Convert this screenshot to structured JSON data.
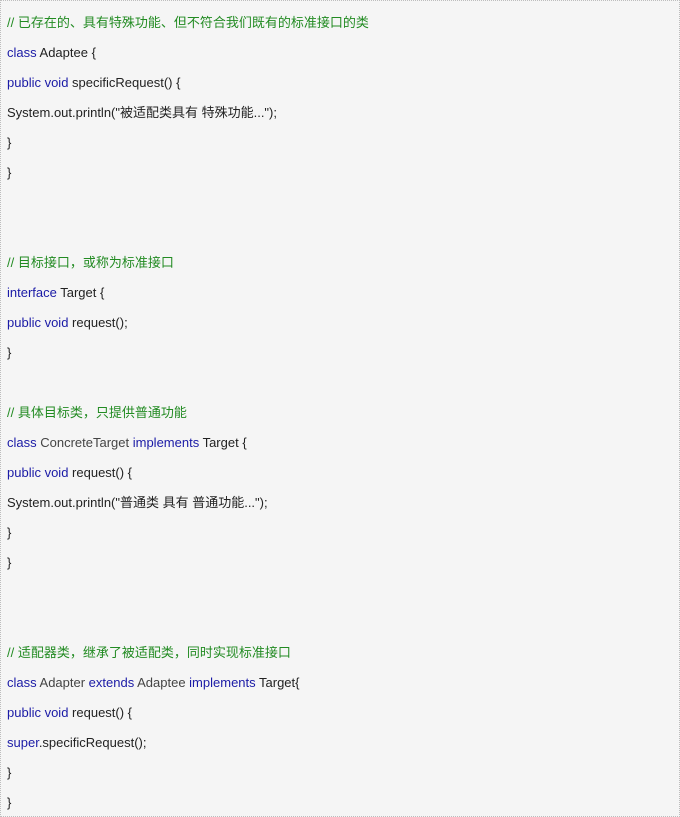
{
  "code": {
    "colors": {
      "background": "#f5f5f5",
      "comment": "#228b22",
      "keyword": "#1a1aa6",
      "text": "#222222",
      "name": "#444444"
    },
    "lines": [
      {
        "tokens": [
          {
            "t": "cm",
            "v": "// 已存在的、具有特殊功能、但不符合我们既有的标准接口的类"
          }
        ]
      },
      {
        "tokens": [
          {
            "t": "kw",
            "v": "class"
          },
          {
            "t": "tx",
            "v": " Adaptee {"
          }
        ]
      },
      {
        "tokens": [
          {
            "t": "kw",
            "v": "public void"
          },
          {
            "t": "tx",
            "v": " specificRequest() {"
          }
        ]
      },
      {
        "tokens": [
          {
            "t": "tx",
            "v": "System.out.println(\"被适配类具有 特殊功能...\");"
          }
        ]
      },
      {
        "tokens": [
          {
            "t": "tx",
            "v": "}"
          }
        ]
      },
      {
        "tokens": [
          {
            "t": "tx",
            "v": "}"
          }
        ]
      },
      {
        "tokens": [
          {
            "t": "cm",
            "v": "// 目标接口，或称为标准接口"
          }
        ]
      },
      {
        "tokens": [
          {
            "t": "kw",
            "v": "interface"
          },
          {
            "t": "tx",
            "v": " Target {"
          }
        ]
      },
      {
        "tokens": [
          {
            "t": "kw",
            "v": "public void"
          },
          {
            "t": "tx",
            "v": " request();"
          }
        ]
      },
      {
        "tokens": [
          {
            "t": "tx",
            "v": "}"
          }
        ]
      },
      {
        "tokens": [
          {
            "t": "cm",
            "v": "// 具体目标类，只提供普通功能"
          }
        ]
      },
      {
        "tokens": [
          {
            "t": "kw",
            "v": "class"
          },
          {
            "t": "nm",
            "v": " ConcreteTarget "
          },
          {
            "t": "kw",
            "v": "implements"
          },
          {
            "t": "tx",
            "v": " Target {"
          }
        ]
      },
      {
        "tokens": [
          {
            "t": "kw",
            "v": "public void"
          },
          {
            "t": "tx",
            "v": " request() {"
          }
        ]
      },
      {
        "tokens": [
          {
            "t": "tx",
            "v": "System.out.println(\"普通类 具有 普通功能...\");"
          }
        ]
      },
      {
        "tokens": [
          {
            "t": "tx",
            "v": "}"
          }
        ]
      },
      {
        "tokens": [
          {
            "t": "tx",
            "v": "}"
          }
        ]
      },
      {
        "tokens": [
          {
            "t": "cm",
            "v": "// 适配器类，继承了被适配类，同时实现标准接口"
          }
        ]
      },
      {
        "tokens": [
          {
            "t": "kw",
            "v": "class"
          },
          {
            "t": "nm",
            "v": " Adapter "
          },
          {
            "t": "kw",
            "v": "extends"
          },
          {
            "t": "nm",
            "v": " Adaptee "
          },
          {
            "t": "kw",
            "v": "implements"
          },
          {
            "t": "tx",
            "v": " Target{"
          }
        ]
      },
      {
        "tokens": [
          {
            "t": "kw",
            "v": "public void"
          },
          {
            "t": "tx",
            "v": " request() {"
          }
        ]
      },
      {
        "tokens": [
          {
            "t": "kw",
            "v": "super"
          },
          {
            "t": "tx",
            "v": ".specificRequest();"
          }
        ]
      },
      {
        "tokens": [
          {
            "t": "tx",
            "v": "}"
          }
        ]
      },
      {
        "tokens": [
          {
            "t": "tx",
            "v": "}"
          }
        ]
      }
    ]
  }
}
